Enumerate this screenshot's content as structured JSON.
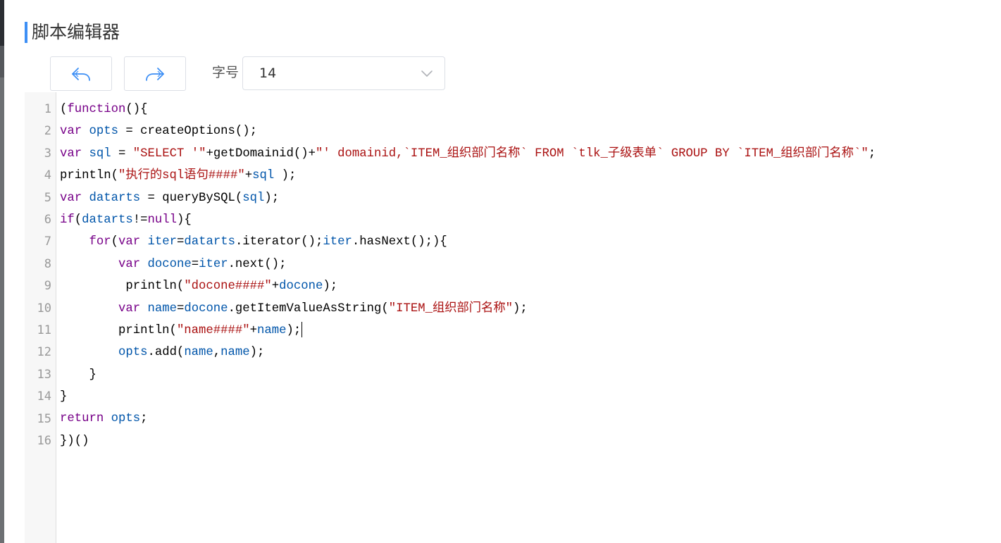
{
  "header": {
    "title": "脚本编辑器"
  },
  "toolbar": {
    "undo_icon": "undo-arrow-icon",
    "redo_icon": "redo-arrow-icon",
    "font_size_label": "字号",
    "font_size_value": "14",
    "accent_color": "#3d8ff5"
  },
  "editor": {
    "line_numbers": [
      "1",
      "2",
      "3",
      "4",
      "5",
      "6",
      "7",
      "8",
      "9",
      "10",
      "11",
      "12",
      "13",
      "14",
      "15",
      "16"
    ],
    "lines": [
      [
        {
          "t": "(",
          "c": "p"
        },
        {
          "t": "function",
          "c": "k"
        },
        {
          "t": "(){",
          "c": "p"
        }
      ],
      [
        {
          "t": "var",
          "c": "k"
        },
        {
          "t": " ",
          "c": "p"
        },
        {
          "t": "opts",
          "c": "v"
        },
        {
          "t": " = createOptions();",
          "c": "p"
        }
      ],
      [
        {
          "t": "var",
          "c": "k"
        },
        {
          "t": " ",
          "c": "p"
        },
        {
          "t": "sql",
          "c": "v"
        },
        {
          "t": " = ",
          "c": "p"
        },
        {
          "t": "\"SELECT '\"",
          "c": "s"
        },
        {
          "t": "+getDomainid()+",
          "c": "p"
        },
        {
          "t": "\"' domainid,`ITEM_组织部门名称` FROM `tlk_子级表单` GROUP BY `ITEM_组织部门名称`\"",
          "c": "s"
        },
        {
          "t": ";",
          "c": "p"
        }
      ],
      [
        {
          "t": "println(",
          "c": "p"
        },
        {
          "t": "\"执行的sql语句####\"",
          "c": "s"
        },
        {
          "t": "+",
          "c": "p"
        },
        {
          "t": "sql",
          "c": "v"
        },
        {
          "t": " );",
          "c": "p"
        }
      ],
      [
        {
          "t": "var",
          "c": "k"
        },
        {
          "t": " ",
          "c": "p"
        },
        {
          "t": "datarts",
          "c": "v"
        },
        {
          "t": " = queryBySQL(",
          "c": "p"
        },
        {
          "t": "sql",
          "c": "v"
        },
        {
          "t": ");",
          "c": "p"
        }
      ],
      [
        {
          "t": "if",
          "c": "k"
        },
        {
          "t": "(",
          "c": "p"
        },
        {
          "t": "datarts",
          "c": "v"
        },
        {
          "t": "!=",
          "c": "p"
        },
        {
          "t": "null",
          "c": "k"
        },
        {
          "t": "){",
          "c": "p"
        }
      ],
      [
        {
          "t": "    ",
          "c": "p"
        },
        {
          "t": "for",
          "c": "k"
        },
        {
          "t": "(",
          "c": "p"
        },
        {
          "t": "var",
          "c": "k"
        },
        {
          "t": " ",
          "c": "p"
        },
        {
          "t": "iter",
          "c": "v"
        },
        {
          "t": "=",
          "c": "p"
        },
        {
          "t": "datarts",
          "c": "v"
        },
        {
          "t": ".iterator();",
          "c": "p"
        },
        {
          "t": "iter",
          "c": "v"
        },
        {
          "t": ".hasNext();){",
          "c": "p"
        }
      ],
      [
        {
          "t": "        ",
          "c": "p"
        },
        {
          "t": "var",
          "c": "k"
        },
        {
          "t": " ",
          "c": "p"
        },
        {
          "t": "docone",
          "c": "v"
        },
        {
          "t": "=",
          "c": "p"
        },
        {
          "t": "iter",
          "c": "v"
        },
        {
          "t": ".next();",
          "c": "p"
        }
      ],
      [
        {
          "t": "         println(",
          "c": "p"
        },
        {
          "t": "\"docone####\"",
          "c": "s"
        },
        {
          "t": "+",
          "c": "p"
        },
        {
          "t": "docone",
          "c": "v"
        },
        {
          "t": ");",
          "c": "p"
        }
      ],
      [
        {
          "t": "        ",
          "c": "p"
        },
        {
          "t": "var",
          "c": "k"
        },
        {
          "t": " ",
          "c": "p"
        },
        {
          "t": "name",
          "c": "v"
        },
        {
          "t": "=",
          "c": "p"
        },
        {
          "t": "docone",
          "c": "v"
        },
        {
          "t": ".getItemValueAsString(",
          "c": "p"
        },
        {
          "t": "\"ITEM_组织部门名称\"",
          "c": "s"
        },
        {
          "t": ");",
          "c": "p"
        }
      ],
      [
        {
          "t": "        println(",
          "c": "p"
        },
        {
          "t": "\"name####\"",
          "c": "s"
        },
        {
          "t": "+",
          "c": "p"
        },
        {
          "t": "name",
          "c": "v"
        },
        {
          "t": ");",
          "c": "p"
        }
      ],
      [
        {
          "t": "        ",
          "c": "p"
        },
        {
          "t": "opts",
          "c": "v"
        },
        {
          "t": ".add(",
          "c": "p"
        },
        {
          "t": "name",
          "c": "v"
        },
        {
          "t": ",",
          "c": "p"
        },
        {
          "t": "name",
          "c": "v"
        },
        {
          "t": ");",
          "c": "p"
        }
      ],
      [
        {
          "t": "    }",
          "c": "p"
        }
      ],
      [
        {
          "t": "}",
          "c": "p"
        }
      ],
      [
        {
          "t": "return",
          "c": "k"
        },
        {
          "t": " ",
          "c": "p"
        },
        {
          "t": "opts",
          "c": "v"
        },
        {
          "t": ";",
          "c": "p"
        }
      ],
      [
        {
          "t": "})()",
          "c": "p"
        }
      ]
    ],
    "cursor_line": 11
  }
}
